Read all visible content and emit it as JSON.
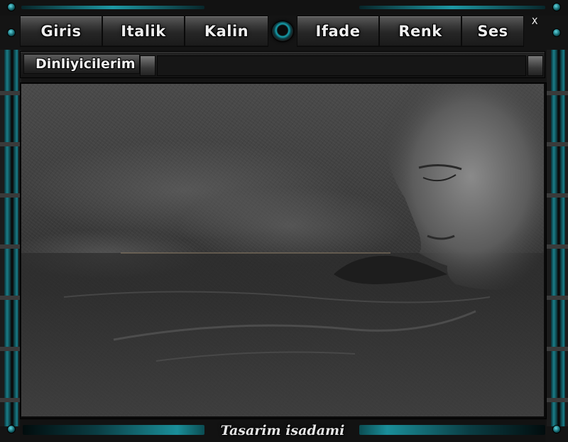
{
  "menu": {
    "buttons": [
      {
        "label": "Giris"
      },
      {
        "label": "Italik"
      },
      {
        "label": "Kalin"
      },
      {
        "label": "Ifade"
      },
      {
        "label": "Renk"
      },
      {
        "label": "Ses"
      }
    ],
    "close_glyph": "ᕽ"
  },
  "playlist": {
    "tab_label": "Dinliyicilerim"
  },
  "footer": {
    "credit": "Tasarim isadami"
  },
  "colors": {
    "accent": "#1a8e99",
    "frame": "#141414",
    "button_text": "#efefef"
  },
  "icons": [
    "center-orb-icon",
    "close-icon"
  ]
}
